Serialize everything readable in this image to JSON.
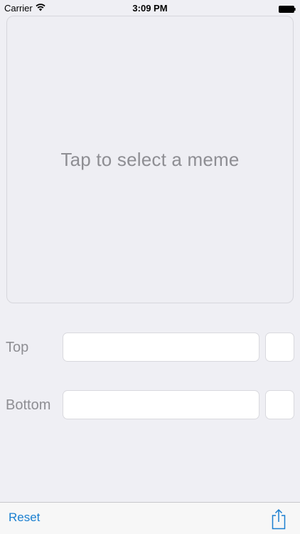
{
  "status_bar": {
    "carrier": "Carrier",
    "time": "3:09 PM"
  },
  "meme_panel": {
    "placeholder": "Tap to select a meme"
  },
  "fields": {
    "top": {
      "label": "Top",
      "value": ""
    },
    "bottom": {
      "label": "Bottom",
      "value": ""
    }
  },
  "toolbar": {
    "reset_label": "Reset",
    "share_icon": "share-icon"
  },
  "colors": {
    "background": "#efeff4",
    "accent": "#1a7fd0",
    "placeholder_text": "#8e8e93"
  }
}
